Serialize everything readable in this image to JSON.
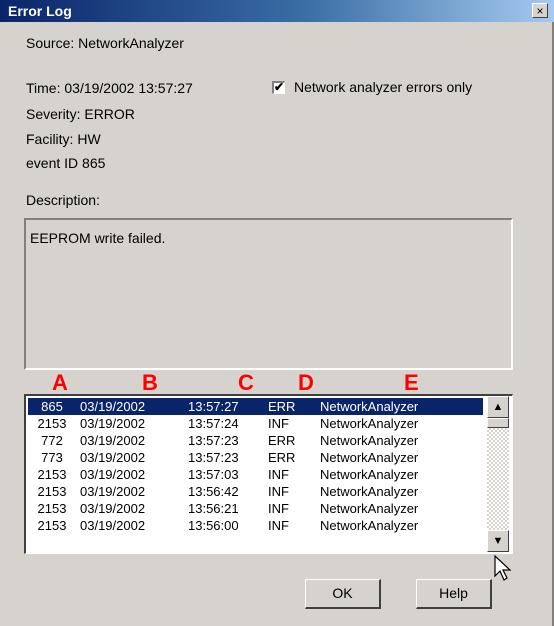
{
  "window": {
    "title": "Error Log",
    "close_glyph": "×"
  },
  "details": {
    "source": "Source: NetworkAnalyzer",
    "time": "Time: 03/19/2002   13:57:27",
    "severity": "Severity: ERROR",
    "facility": "Facility: HW",
    "event_id": "event ID 865"
  },
  "filter": {
    "label": "Network analyzer errors only",
    "checked": true,
    "check_glyph": "✔"
  },
  "description": {
    "label": "Description:",
    "text": "EEPROM write failed."
  },
  "column_markers": [
    "A",
    "B",
    "C",
    "D",
    "E"
  ],
  "log": {
    "rows": [
      {
        "id": "865",
        "date": "03/19/2002",
        "time": "13:57:27",
        "sev": "ERR",
        "source": "NetworkAnalyzer",
        "selected": true
      },
      {
        "id": "2153",
        "date": "03/19/2002",
        "time": "13:57:24",
        "sev": "INF",
        "source": "NetworkAnalyzer"
      },
      {
        "id": "772",
        "date": "03/19/2002",
        "time": "13:57:23",
        "sev": "ERR",
        "source": "NetworkAnalyzer"
      },
      {
        "id": "773",
        "date": "03/19/2002",
        "time": "13:57:23",
        "sev": "ERR",
        "source": "NetworkAnalyzer"
      },
      {
        "id": "2153",
        "date": "03/19/2002",
        "time": "13:57:03",
        "sev": "INF",
        "source": "NetworkAnalyzer"
      },
      {
        "id": "2153",
        "date": "03/19/2002",
        "time": "13:56:42",
        "sev": "INF",
        "source": "NetworkAnalyzer"
      },
      {
        "id": "2153",
        "date": "03/19/2002",
        "time": "13:56:21",
        "sev": "INF",
        "source": "NetworkAnalyzer"
      },
      {
        "id": "2153",
        "date": "03/19/2002",
        "time": "13:56:00",
        "sev": "INF",
        "source": "NetworkAnalyzer"
      }
    ]
  },
  "scrollbar": {
    "up_glyph": "▲",
    "down_glyph": "▼"
  },
  "buttons": {
    "ok": "OK",
    "help": "Help"
  },
  "colors": {
    "title_bar": "#0a246a",
    "selection": "#0a246a",
    "marker_red": "#ff0000",
    "dialog_face": "#d6d3ce"
  },
  "icons": {
    "cursor": "mouse-pointer-icon",
    "close": "close-icon",
    "checkbox": "checkmark-icon"
  }
}
